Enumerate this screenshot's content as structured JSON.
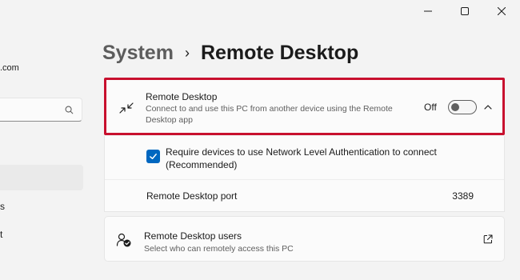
{
  "sidebar": {
    "account_email_fragment": ".com",
    "search": {
      "placeholder": ""
    },
    "nav_fragments": [
      "s",
      "t"
    ]
  },
  "breadcrumb": {
    "parent": "System",
    "separator": "›",
    "current": "Remote Desktop"
  },
  "remote_desktop_card": {
    "title": "Remote Desktop",
    "description": "Connect to and use this PC from another device using the Remote Desktop app",
    "toggle_state_label": "Off",
    "toggle_on": false,
    "icon": "remote-desktop-icon",
    "expanded": true,
    "highlight_color": "#c8102e"
  },
  "settings": {
    "nla": {
      "label_line1": "Require devices to use Network Level Authentication to connect",
      "label_line2": "(Recommended)",
      "checked": true
    },
    "port": {
      "label": "Remote Desktop port",
      "value": "3389"
    }
  },
  "users_card": {
    "title": "Remote Desktop users",
    "description": "Select who can remotely access this PC",
    "icon": "users-icon",
    "action_icon": "external-link-icon"
  },
  "colors": {
    "accent": "#0067c0",
    "highlight_border": "#c8102e"
  }
}
